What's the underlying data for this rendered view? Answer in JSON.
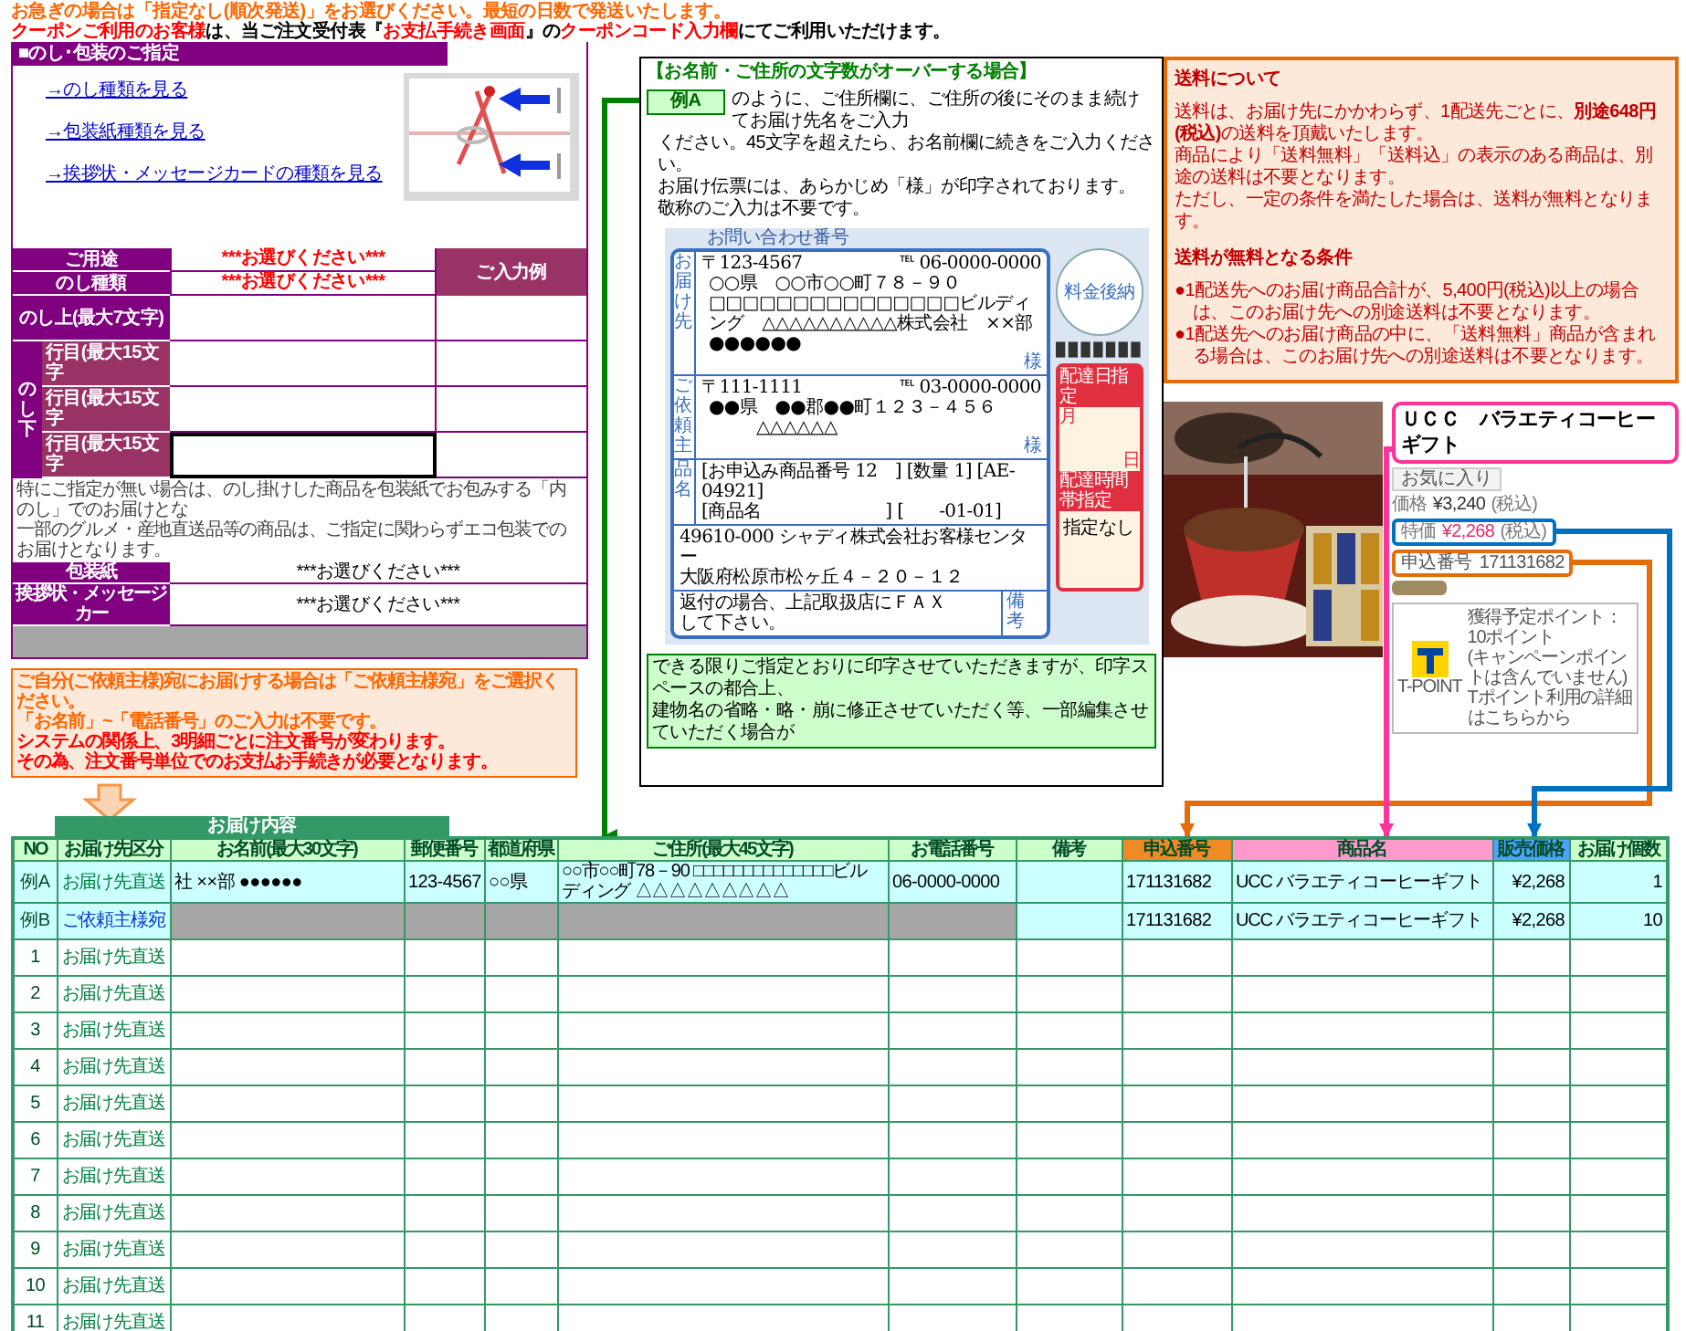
{
  "notices": [
    {
      "text": "お急ぎの場合は「指定なし(順次発送)」をお選びください。最短の日数で発送いたします。",
      "color": "#ff6600"
    },
    {
      "text": "**クーポンご利用のお客様**は、当ご注文受付表『**お支払手続き画面**』の**クーポンコード入力欄**にてご利用いただけます。",
      "color": "#000000"
    }
  ],
  "noshi_panel": {
    "title": "■のし･包装のご指定",
    "links": [
      "→のし種類を見る",
      "→包装紙種類を見る",
      "→挨拶状・メッセージカードの種類を見る"
    ],
    "picture": {
      "kind": "picture"
    },
    "example_header": "ご入力例",
    "selects": [
      {
        "label": "ご用途",
        "value": "***お選びください***",
        "color": "#ff0000"
      },
      {
        "label": "のし種類",
        "value": "***お選びください***",
        "color": "#ff0000"
      }
    ],
    "noshi_top": {
      "label": "のし上(最大7文字)"
    },
    "noshi_bottom": {
      "label": "のし下",
      "lines": [
        {
          "label": "行目(最大15文字",
          "selected": false
        },
        {
          "label": "行目(最大15文字",
          "selected": false
        },
        {
          "label": "行目(最大15文字",
          "selected": true
        }
      ]
    },
    "note": [
      "特にご指定が無い場合は、のし掛けした商品を包装紙でお包みする「内のし」でのお届けとな",
      "一部のグルメ・産地直送品等の商品は、ご指定に関わらずエコ包装でのお届けとなります。"
    ],
    "wrapping": [
      {
        "label": "包装紙",
        "value": "***お選びください***",
        "color": "#000000"
      },
      {
        "label": "挨拶状・メッセージカー",
        "value": "***お選びください***",
        "color": "#000000"
      }
    ]
  },
  "sender_note": [
    {
      "text": "ご自分(ご依頼主様)宛にお届けする場合は「ご依頼主様宛」をご選択ください。",
      "color": "#ff6600"
    },
    {
      "text": "「お名前」~「電話番号」のご入力は不要です。",
      "color": "#ff6600"
    },
    {
      "text": "システムの関係上、3明細ごとに注文番号が変わります。",
      "color": "#ff0000"
    },
    {
      "text": "その為、注文番号単位でのお支払お手続きが必要となります。",
      "color": "#ff0000"
    }
  ],
  "overflow_help": {
    "title": "【お名前・ご住所の文字数がオーバーする場合】",
    "example_tag": "例A",
    "lead": "のように、ご住所欄に、ご住所の後にそのまま続けてお届け先名をご入力",
    "lines": [
      "ください。45文字を超えたら、お名前欄に続きをご入力ください。",
      "お届け伝票には、あらかじめ「様」が印字されております。",
      "敬称のご入力は不要です。"
    ],
    "slip": {
      "header": "お問い合わせ番号",
      "to": {
        "label": "お届け先",
        "postal": "〒123-4567",
        "tel": "℡ 06-0000-0000",
        "address": "○○県　○○市○○町７８－９０　□□□□□□□□□□□□□□□ビルディング　△△△△△△△△△△株式会社　××部　●●●●●●",
        "honorific": "様"
      },
      "from": {
        "label": "ご依頼主",
        "postal": "〒111-1111",
        "tel": "℡ 03-0000-0000",
        "address": "●●県　●●郡●●町１２３－４５６",
        "name": "△△△△△△",
        "honorific": "様"
      },
      "stamp": "料金後納",
      "delivery": {
        "date_label": "配達日指定",
        "month": "月",
        "day": "日",
        "time_label": "配達時間帯指定",
        "time": "指定なし"
      },
      "item_label": "品名",
      "items": [
        "[お申込み商品番号 12　] [数量 1] [AE-04921]",
        "[商品名　　　　　　　] [　　-01-01]"
      ],
      "sender": [
        "49610-000 シャディ株式会社お客様センター",
        "大阪府松原市松ヶ丘４－２０－１２"
      ],
      "fax": [
        "返付の場合、上記取扱店にＦＡＸ",
        "して下さい。"
      ],
      "remarks_label": "備考"
    },
    "print_note": [
      "できる限りご指定とおりに印字させていただきますが、印字スペースの都合上、",
      "建物名の省略・略・崩に修正させていただく等、一部編集させていただく場合が"
    ]
  },
  "shipping_info": {
    "title": "送料について",
    "paragraphs": [
      "送料は、お届け先にかかわらず、1配送先ごとに、**別途648円(税込)**の送料を頂戴いたします。",
      "商品により「送料無料」「送料込」の表示のある商品は、別途の送料は不要となります。",
      "ただし、一定の条件を満たした場合は、送料が無料となります。"
    ],
    "conditions_title": "送料が無料となる条件",
    "conditions": [
      "●1配送先へのお届け商品合計が、5,400円(税込)以上の場合は、このお届け先への別途送料は不要となります。",
      "●1配送先へのお届け商品の中に、「送料無料」商品が含まれる場合は、このお届け先への別途送料は不要となります。"
    ]
  },
  "product": {
    "photo": {
      "kind": "picture"
    },
    "name": "ＵＣＣ　バラエティコーヒーギフト",
    "favorite": "お気に入り",
    "price_label": "価格",
    "price": "¥3,240",
    "price_tax": "(税込)",
    "sale_label": "特価",
    "sale_price": "¥2,268",
    "sale_tax": "(税込)",
    "number_label": "申込番号",
    "number": "171131682",
    "tpoint": {
      "logo": "T-POINT",
      "lines": [
        "獲得予定ポイント：10ポイント",
        "(キャンペーンポイントは含んでいません)",
        "Tポイント利用の詳細はこちらから"
      ]
    }
  },
  "orders": {
    "group_title": "お届け内容",
    "columns": [
      {
        "label": "NO",
        "color": "#ccffcc"
      },
      {
        "label": "お届け先区分",
        "color": "#ccffcc"
      },
      {
        "label": "お名前(最大30文字)",
        "color": "#ccffcc"
      },
      {
        "label": "郵便番号",
        "color": "#ccffcc"
      },
      {
        "label": "都道府県",
        "color": "#ccffcc"
      },
      {
        "label": "ご住所(最大45文字)",
        "color": "#ccffcc"
      },
      {
        "label": "お電話番号",
        "color": "#ccffcc"
      },
      {
        "label": "備考",
        "color": "#ccffcc"
      },
      {
        "label": "申込番号",
        "color": "#f08a24"
      },
      {
        "label": "商品名",
        "color": "#ff99cc"
      },
      {
        "label": "販売価格",
        "color": "#4da3ff"
      },
      {
        "label": "お届け個数",
        "color": "#ccffcc"
      }
    ],
    "rows": [
      {
        "no": "例A",
        "kind": "example",
        "category": "お届け先直送",
        "name": "社 ××部 ●●●●●●",
        "postal": "123-4567",
        "prefecture": "○○県",
        "address": "○○市○○町78－90 □□□□□□□□□□□□□□ビルディング △△△△△△△△△",
        "phone": "06-0000-0000",
        "number": "171131682",
        "product": "UCC バラエティコーヒーギフト",
        "price": "¥2,268",
        "quantity": "1"
      },
      {
        "no": "例B",
        "kind": "sender",
        "category": "ご依頼主様宛",
        "number": "171131682",
        "product": "UCC バラエティコーヒーギフト",
        "price": "¥2,268",
        "quantity": "10"
      },
      {
        "no": "1",
        "kind": "entry",
        "category": "お届け先直送"
      },
      {
        "no": "2",
        "kind": "entry",
        "category": "お届け先直送"
      },
      {
        "no": "3",
        "kind": "entry",
        "category": "お届け先直送"
      },
      {
        "no": "4",
        "kind": "entry",
        "category": "お届け先直送"
      },
      {
        "no": "5",
        "kind": "entry",
        "category": "お届け先直送"
      },
      {
        "no": "6",
        "kind": "entry",
        "category": "お届け先直送"
      },
      {
        "no": "7",
        "kind": "entry",
        "category": "お届け先直送"
      },
      {
        "no": "8",
        "kind": "entry",
        "category": "お届け先直送"
      },
      {
        "no": "9",
        "kind": "entry",
        "category": "お届け先直送"
      },
      {
        "no": "10",
        "kind": "entry",
        "category": "お届け先直送"
      },
      {
        "no": "11",
        "kind": "entry",
        "category": "お届け先直送"
      }
    ]
  }
}
